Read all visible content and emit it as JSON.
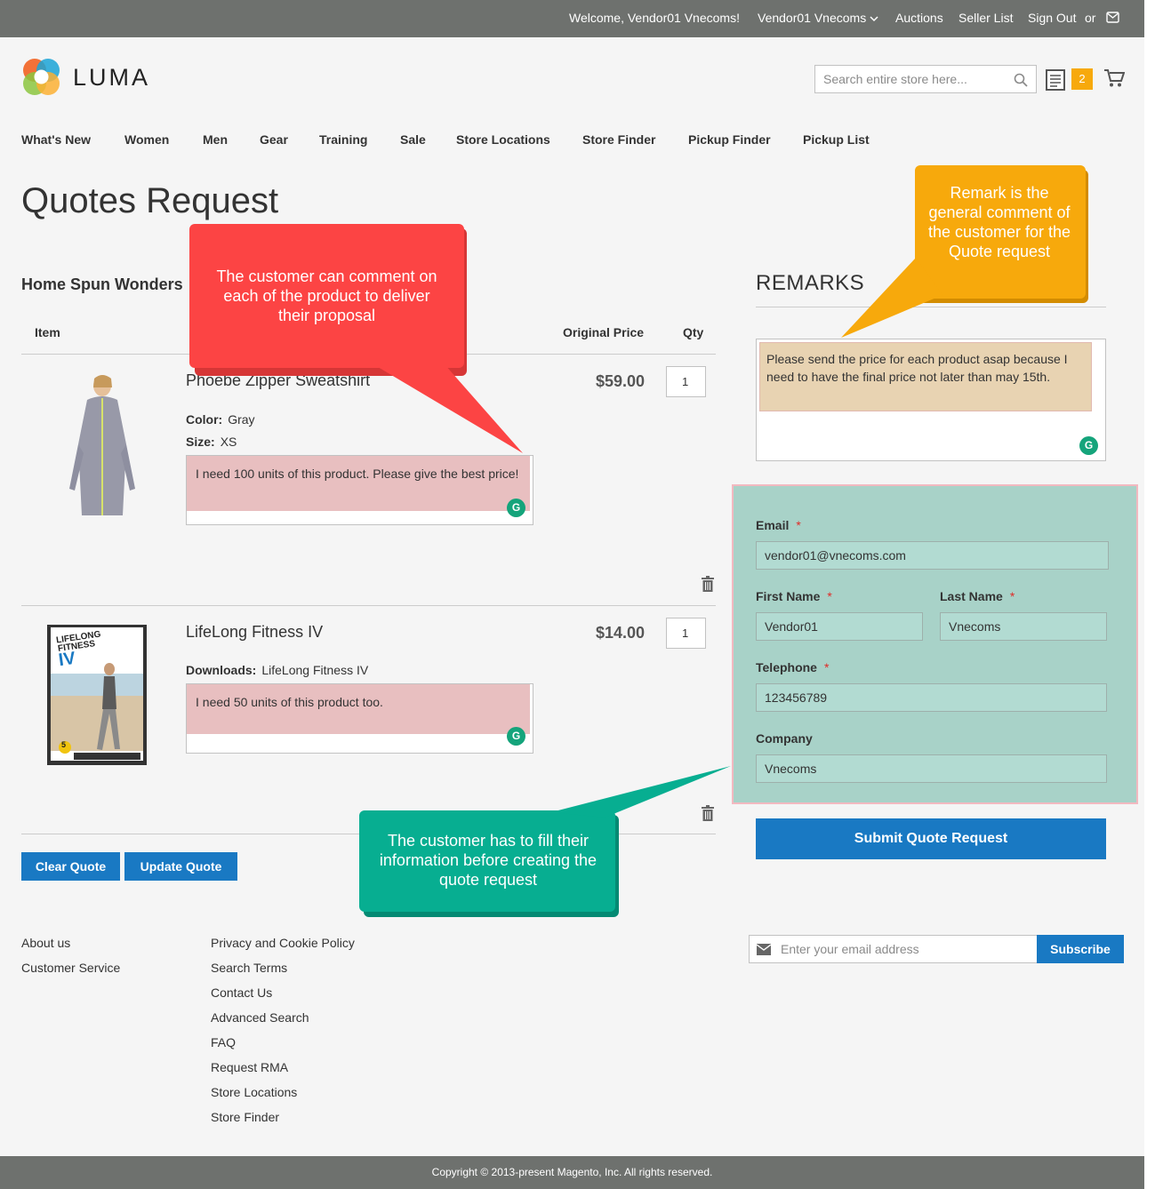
{
  "topbar": {
    "welcome": "Welcome, Vendor01 Vnecoms!",
    "account": "Vendor01 Vnecoms",
    "auctions": "Auctions",
    "seller_list": "Seller List",
    "sign_out": "Sign Out",
    "or": "or"
  },
  "header": {
    "logo_text": "LUMA",
    "search_placeholder": "Search entire store here...",
    "quote_count": "2"
  },
  "nav": [
    "What's New",
    "Women",
    "Men",
    "Gear",
    "Training",
    "Sale",
    "Store Locations",
    "Store Finder",
    "Pickup Finder",
    "Pickup List"
  ],
  "page_title": "Quotes Request",
  "seller_name": "Home Spun Wonders",
  "table": {
    "col_item": "Item",
    "col_price": "Original Price",
    "col_qty": "Qty"
  },
  "items": [
    {
      "name": "Phoebe Zipper Sweatshirt",
      "price": "$59.00",
      "qty": "1",
      "attr1_label": "Color:",
      "attr1_value": "Gray",
      "attr2_label": "Size:",
      "attr2_value": "XS",
      "comment": "I need 100 units of this product. Please give the best price!"
    },
    {
      "name": "LifeLong Fitness IV",
      "price": "$14.00",
      "qty": "1",
      "attr1_label": "Downloads:",
      "attr1_value": "LifeLong Fitness IV",
      "comment": "I need 50 units of this product too.",
      "cover_title_1": "LIFELONG",
      "cover_title_2": "FITNESS",
      "cover_title_3": "IV",
      "cover_badge": "5"
    }
  ],
  "buttons": {
    "clear_quote": "Clear Quote",
    "update_quote": "Update Quote",
    "submit": "Submit Quote Request",
    "subscribe": "Subscribe"
  },
  "remarks": {
    "title": "REMARKS",
    "text": "Please send the price for each product asap because I need to have the final price not later than may 15th."
  },
  "form": {
    "email_label": "Email",
    "email_value": "vendor01@vnecoms.com",
    "first_name_label": "First Name",
    "first_name_value": "Vendor01",
    "last_name_label": "Last Name",
    "last_name_value": "Vnecoms",
    "telephone_label": "Telephone",
    "telephone_value": "123456789",
    "company_label": "Company",
    "company_value": "Vnecoms",
    "required_mark": "*"
  },
  "callouts": {
    "red": "The customer can comment on each of the product to deliver their proposal",
    "orange": "Remark is the general comment of the customer for the Quote request",
    "green": "The customer has to fill their information before creating the quote request"
  },
  "footer": {
    "col1": [
      "About us",
      "Customer Service"
    ],
    "col2": [
      "Privacy and Cookie Policy",
      "Search Terms",
      "Contact Us",
      "Advanced Search",
      "FAQ",
      "Request RMA",
      "Store Locations",
      "Store Finder"
    ],
    "newsletter_placeholder": "Enter your email address",
    "copyright": "Copyright © 2013-present Magento, Inc. All rights reserved."
  },
  "colors": {
    "brand_blue": "#1979c3",
    "callout_red": "#fc4444",
    "callout_orange": "#f7a90c",
    "callout_green": "#07ae91",
    "form_bg": "#a8d2c8"
  }
}
